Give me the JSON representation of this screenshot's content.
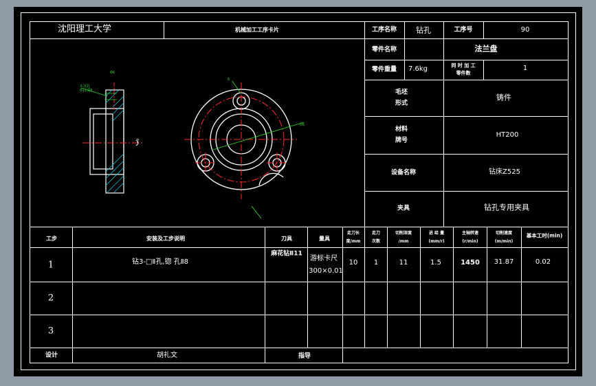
{
  "header": {
    "school": "沈阳理工大学",
    "card_title": "机械加工工序卡片",
    "process_name_label": "工序名称",
    "process_name": "钻孔",
    "process_no_label": "工序号",
    "process_no": "90",
    "part_name_label": "零件名称",
    "part_name": "法兰盘",
    "part_weight_label": "零件重量",
    "part_weight": "7.6kg",
    "simul_parts_label_1": "同 时 加 工",
    "simul_parts_label_2": "零件数",
    "simul_parts": "1"
  },
  "specs": [
    {
      "label_1": "毛坯",
      "label_2": "形式",
      "value": "铸件"
    },
    {
      "label_1": "材料",
      "label_2": "牌号",
      "value": "HT200"
    },
    {
      "label_1": "设备名称",
      "label_2": "",
      "value": "钻床Z525"
    },
    {
      "label_1": "夹具",
      "label_2": "",
      "value": "钻孔专用夹具"
    }
  ],
  "table": {
    "headers": {
      "step": "工步",
      "desc": "安装及工步说明",
      "tool": "刀具",
      "gauge": "量具",
      "stroke_1": "走刀长",
      "stroke_2": "度/mm",
      "passes_1": "走刀",
      "passes_2": "次数",
      "depth_1": "切削深度",
      "depth_2": "/mm",
      "feed_1": "进 给 量",
      "feed_2": "(mm/r)",
      "speed_1": "主轴转速",
      "speed_2": "(r/min)",
      "vel_1": "切削速度",
      "vel_2": "(m/min)",
      "time": "基本工时(min)"
    },
    "rows": [
      {
        "step": "1",
        "desc": "钻3-□Ⅱ孔,锪 孔Ⅱ8",
        "tool": "麻花钻Ⅱ11",
        "gauge_1": "游标卡尺",
        "gauge_2": "300×0.01",
        "stroke": "10",
        "passes": "1",
        "depth": "11",
        "feed": "1.5",
        "speed": "1450",
        "vel": "31.87",
        "time": "0.02"
      },
      {
        "step": "2"
      },
      {
        "step": "3"
      }
    ]
  },
  "footer": {
    "design_label": "设计",
    "designer": "胡礼文",
    "guide_label": "指导"
  },
  "drawing": {
    "dim_small": "Φ6",
    "dim_c": "6",
    "dim_dia": "Φ6",
    "dim_note_1": "3-沉孔",
    "dim_note_2": "Φ11深8",
    "section_mark": "?"
  },
  "colors": {
    "background": "#000000",
    "frame": "#ffffff",
    "part_outline": "#ffffff",
    "centerline": "#ff2a2a",
    "dimension": "#2ed12e",
    "hatch": "#00c8d6",
    "window_bg": "#8e9aa6"
  }
}
